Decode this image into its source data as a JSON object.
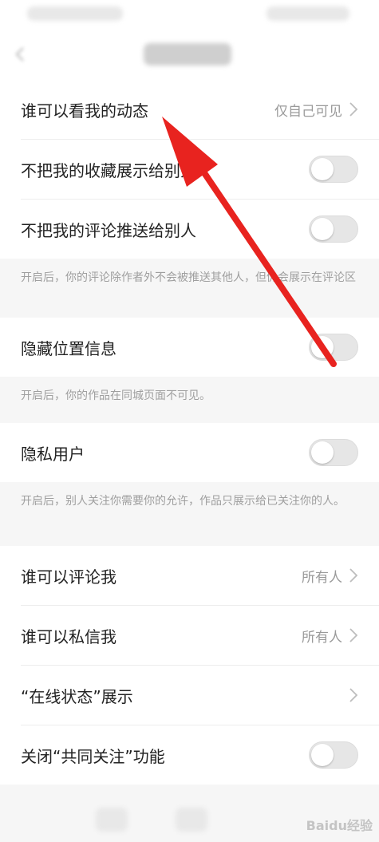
{
  "rows": [
    {
      "label": "谁可以看我的动态",
      "value": "仅自己可见"
    },
    {
      "label": "不把我的收藏展示给别人"
    },
    {
      "label": "不把我的评论推送给别人"
    },
    {
      "label": "隐藏位置信息"
    },
    {
      "label": "隐私用户"
    },
    {
      "label": "谁可以评论我",
      "value": "所有人"
    },
    {
      "label": "谁可以私信我",
      "value": "所有人"
    },
    {
      "label": "“在线状态”展示"
    },
    {
      "label": "关闭“共同关注”功能"
    }
  ],
  "notes": [
    "开启后，你的评论除作者外不会被推送其他人，但仍会展示在评论区",
    "开启后，你的作品在同城页面不可见。",
    "开启后，别人关注你需要你的允许，作品只展示给已关注你的人。"
  ],
  "toggles": {
    "favorites": false,
    "comments_push": false,
    "hide_location": false,
    "private_user": false,
    "common_follow": false
  },
  "watermark": "Baidu经验",
  "colors": {
    "annotation_arrow": "#e8231f"
  }
}
